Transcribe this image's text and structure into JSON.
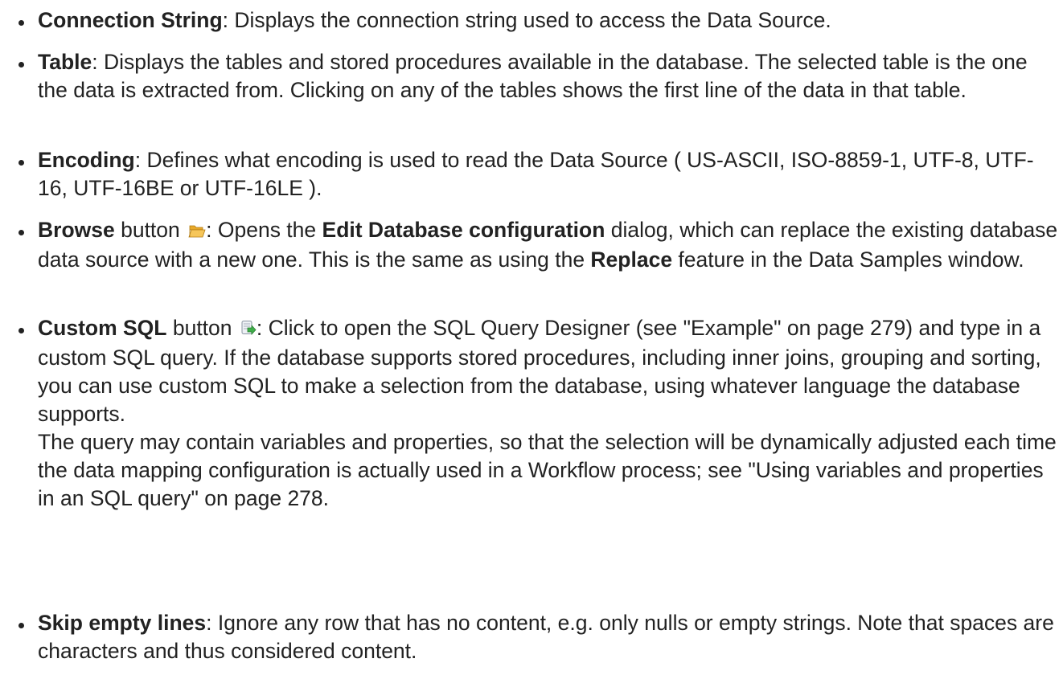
{
  "items": {
    "connection_string": {
      "term": "Connection String",
      "text": ": Displays the connection string used to access the Data Source."
    },
    "table": {
      "term": "Table",
      "text": ": Displays the tables and stored procedures available in the database. The selected table is the one the data is extracted from. Clicking on any of the tables shows the first line of the data in that table."
    },
    "encoding": {
      "term": "Encoding",
      "text": ": Defines what encoding is used to read the Data Source ( US-ASCII, ISO-8859-1, UTF-8, UTF-16, UTF-16BE or UTF-16LE )."
    },
    "browse": {
      "term": "Browse",
      "after_term": " button ",
      "icon": "folder-open-icon",
      "text_a": ": Opens the ",
      "bold_a": "Edit Database configuration",
      "text_b": " dialog, which can replace the existing database data source with a new one. This is the same as using the ",
      "bold_b": "Replace",
      "text_c": " feature in the Data Samples window."
    },
    "custom_sql": {
      "term": "Custom SQL",
      "after_term": " button ",
      "icon": "database-export-icon",
      "text_a": ": Click to open the SQL Query Designer (see \"Example\" on page 279) and type in a custom SQL query. If the database supports stored procedures, including inner joins, grouping and sorting, you can use custom SQL to make a selection from the database, using whatever language the database supports.",
      "text_b": "The query may contain variables and properties, so that the selection will be dynamically adjusted each time the data mapping configuration is actually used in a Workflow process; see \"Using variables and properties in an SQL query\" on page 278."
    },
    "skip_empty_lines": {
      "term": "Skip empty lines",
      "text": ": Ignore any row that has no content, e.g. only nulls or empty strings. Note that spaces are characters and thus considered content."
    }
  },
  "colors": {
    "text": "#222222",
    "folder_icon": "#f0b437",
    "sql_icon_arrow": "#3fae49"
  }
}
